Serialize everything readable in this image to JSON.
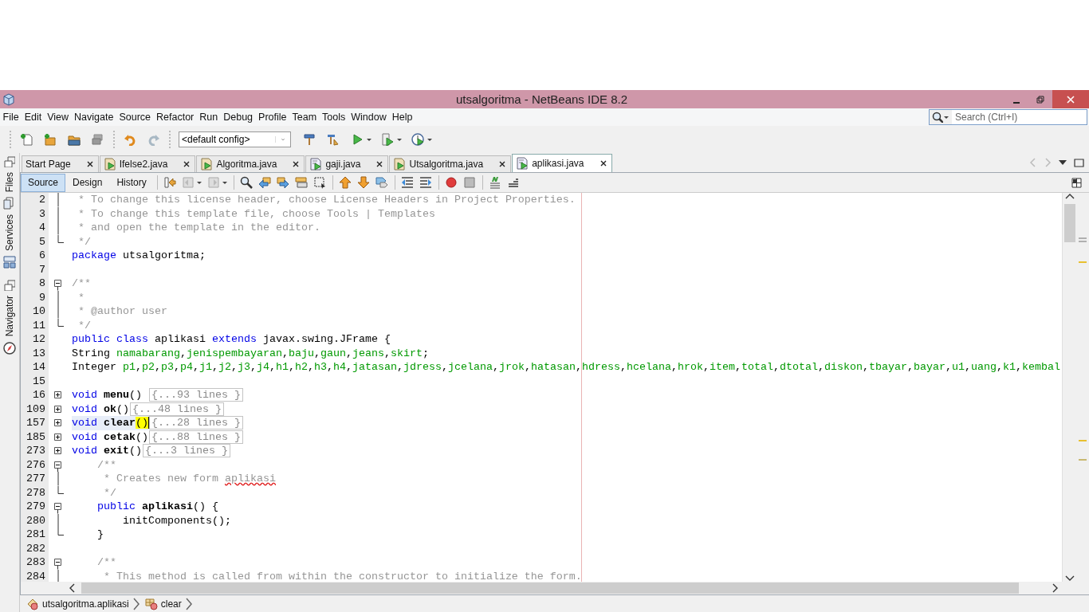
{
  "window": {
    "title": "utsalgoritma - NetBeans IDE 8.2"
  },
  "menu": [
    "File",
    "Edit",
    "View",
    "Navigate",
    "Source",
    "Refactor",
    "Run",
    "Debug",
    "Profile",
    "Team",
    "Tools",
    "Window",
    "Help"
  ],
  "search": {
    "placeholder": "Search (Ctrl+I)"
  },
  "toolbar": {
    "config": "<default config>"
  },
  "side_panels": [
    {
      "tabs": [
        {
          "label": "Files",
          "kind": "files"
        },
        {
          "label": "Services",
          "kind": "services"
        }
      ]
    },
    {
      "tabs": [
        {
          "label": "Navigator",
          "kind": "navigator"
        }
      ]
    }
  ],
  "tabs": [
    {
      "label": "Start Page",
      "kind": "page",
      "selected": false
    },
    {
      "label": "Ifelse2.java",
      "kind": "main",
      "selected": false
    },
    {
      "label": "Algoritma.java",
      "kind": "main",
      "selected": false
    },
    {
      "label": "gaji.java",
      "kind": "form",
      "selected": false
    },
    {
      "label": "Utsalgoritma.java",
      "kind": "main",
      "selected": false
    },
    {
      "label": "aplikasi.java",
      "kind": "form",
      "selected": true
    }
  ],
  "view_tabs": [
    {
      "label": "Source",
      "selected": true
    },
    {
      "label": "Design",
      "selected": false
    },
    {
      "label": "History",
      "selected": false
    }
  ],
  "code": [
    {
      "number": "2",
      "kind": "guide",
      "current": false,
      "tokens": [
        {
          "kind": "comment",
          "text": " * To change this license header, choose License Headers in Project Properties."
        }
      ]
    },
    {
      "number": "3",
      "kind": "guide",
      "current": false,
      "tokens": [
        {
          "kind": "comment",
          "text": " * To change this template file, choose Tools | Templates"
        }
      ]
    },
    {
      "number": "4",
      "kind": "guide",
      "current": false,
      "tokens": [
        {
          "kind": "comment",
          "text": " * and open the template in the editor."
        }
      ]
    },
    {
      "number": "5",
      "kind": "end",
      "current": false,
      "tokens": [
        {
          "kind": "comment",
          "text": " */"
        }
      ]
    },
    {
      "number": "6",
      "kind": "plain",
      "current": false,
      "tokens": [
        {
          "kind": "kw",
          "text": "package"
        },
        {
          "kind": "plain",
          "text": " utsalgoritma;"
        }
      ]
    },
    {
      "number": "7",
      "kind": "plain",
      "current": false
    },
    {
      "number": "8",
      "kind": "collapse",
      "current": false,
      "tokens": [
        {
          "kind": "comment",
          "text": "/**"
        }
      ]
    },
    {
      "number": "9",
      "kind": "guide",
      "current": false,
      "tokens": [
        {
          "kind": "comment",
          "text": " *"
        }
      ]
    },
    {
      "number": "10",
      "kind": "guide",
      "current": false,
      "tokens": [
        {
          "kind": "comment",
          "text": " * @author user"
        }
      ]
    },
    {
      "number": "11",
      "kind": "end",
      "current": false,
      "tokens": [
        {
          "kind": "comment",
          "text": " */"
        }
      ]
    },
    {
      "number": "12",
      "kind": "plain",
      "current": false,
      "tokens": [
        {
          "kind": "kw",
          "text": "public class"
        },
        {
          "kind": "plain",
          "text": " aplikasi "
        },
        {
          "kind": "kw",
          "text": "extends"
        },
        {
          "kind": "plain",
          "text": " javax.swing.JFrame {"
        }
      ]
    },
    {
      "number": "13",
      "kind": "plain",
      "current": false,
      "tokens": [
        {
          "kind": "plain",
          "text": "String "
        },
        {
          "kind": "field",
          "text": "namabarang"
        },
        {
          "kind": "plain",
          "text": ","
        },
        {
          "kind": "field",
          "text": "jenispembayaran"
        },
        {
          "kind": "plain",
          "text": ","
        },
        {
          "kind": "field",
          "text": "baju"
        },
        {
          "kind": "plain",
          "text": ","
        },
        {
          "kind": "field",
          "text": "gaun"
        },
        {
          "kind": "plain",
          "text": ","
        },
        {
          "kind": "field",
          "text": "jeans"
        },
        {
          "kind": "plain",
          "text": ","
        },
        {
          "kind": "field",
          "text": "skirt"
        },
        {
          "kind": "plain",
          "text": ";"
        }
      ]
    },
    {
      "number": "14",
      "kind": "plain",
      "current": false,
      "tokens": [
        {
          "kind": "plain",
          "text": "Integer "
        },
        {
          "kind": "field",
          "text": "p1"
        },
        {
          "kind": "plain",
          "text": ","
        },
        {
          "kind": "field",
          "text": "p2"
        },
        {
          "kind": "plain",
          "text": ","
        },
        {
          "kind": "field",
          "text": "p3"
        },
        {
          "kind": "plain",
          "text": ","
        },
        {
          "kind": "field",
          "text": "p4"
        },
        {
          "kind": "plain",
          "text": ","
        },
        {
          "kind": "field",
          "text": "j1"
        },
        {
          "kind": "plain",
          "text": ","
        },
        {
          "kind": "field",
          "text": "j2"
        },
        {
          "kind": "plain",
          "text": ","
        },
        {
          "kind": "field",
          "text": "j3"
        },
        {
          "kind": "plain",
          "text": ","
        },
        {
          "kind": "field",
          "text": "j4"
        },
        {
          "kind": "plain",
          "text": ","
        },
        {
          "kind": "field",
          "text": "h1"
        },
        {
          "kind": "plain",
          "text": ","
        },
        {
          "kind": "field",
          "text": "h2"
        },
        {
          "kind": "plain",
          "text": ","
        },
        {
          "kind": "field",
          "text": "h3"
        },
        {
          "kind": "plain",
          "text": ","
        },
        {
          "kind": "field",
          "text": "h4"
        },
        {
          "kind": "plain",
          "text": ","
        },
        {
          "kind": "field",
          "text": "jatasan"
        },
        {
          "kind": "plain",
          "text": ","
        },
        {
          "kind": "field",
          "text": "jdress"
        },
        {
          "kind": "plain",
          "text": ","
        },
        {
          "kind": "field",
          "text": "jcelana"
        },
        {
          "kind": "plain",
          "text": ","
        },
        {
          "kind": "field",
          "text": "jrok"
        },
        {
          "kind": "plain",
          "text": ","
        },
        {
          "kind": "field",
          "text": "hatasan"
        },
        {
          "kind": "plain",
          "text": ","
        },
        {
          "kind": "field",
          "text": "hdress"
        },
        {
          "kind": "plain",
          "text": ","
        },
        {
          "kind": "field",
          "text": "hcelana"
        },
        {
          "kind": "plain",
          "text": ","
        },
        {
          "kind": "field",
          "text": "hrok"
        },
        {
          "kind": "plain",
          "text": ","
        },
        {
          "kind": "field",
          "text": "item"
        },
        {
          "kind": "plain",
          "text": ","
        },
        {
          "kind": "field",
          "text": "total"
        },
        {
          "kind": "plain",
          "text": ","
        },
        {
          "kind": "field",
          "text": "dtotal"
        },
        {
          "kind": "plain",
          "text": ","
        },
        {
          "kind": "field",
          "text": "diskon"
        },
        {
          "kind": "plain",
          "text": ","
        },
        {
          "kind": "field",
          "text": "tbayar"
        },
        {
          "kind": "plain",
          "text": ","
        },
        {
          "kind": "field",
          "text": "bayar"
        },
        {
          "kind": "plain",
          "text": ","
        },
        {
          "kind": "field",
          "text": "u1"
        },
        {
          "kind": "plain",
          "text": ","
        },
        {
          "kind": "field",
          "text": "uang"
        },
        {
          "kind": "plain",
          "text": ","
        },
        {
          "kind": "field",
          "text": "k1"
        },
        {
          "kind": "plain",
          "text": ","
        },
        {
          "kind": "field",
          "text": "kembal"
        }
      ]
    },
    {
      "number": "15",
      "kind": "plain",
      "current": false
    },
    {
      "number": "16",
      "kind": "expand",
      "current": false,
      "tokens": [
        {
          "kind": "kw",
          "text": "void"
        },
        {
          "kind": "bold",
          "text": " menu"
        },
        {
          "kind": "plain",
          "text": "() "
        }
      ],
      "folded": "{...93 lines }"
    },
    {
      "number": "109",
      "kind": "expand",
      "current": false,
      "tokens": [
        {
          "kind": "kw",
          "text": "void"
        },
        {
          "kind": "bold",
          "text": " ok"
        },
        {
          "kind": "plain",
          "text": "()"
        }
      ],
      "folded": "{...48 lines }"
    },
    {
      "number": "157",
      "kind": "expand",
      "current": true,
      "tokens": [
        {
          "kind": "kw",
          "text": "void"
        },
        {
          "kind": "bold",
          "text": " clear"
        },
        {
          "kind": "match",
          "text": "()"
        }
      ],
      "folded": "{...28 lines }"
    },
    {
      "number": "185",
      "kind": "expand",
      "current": false,
      "tokens": [
        {
          "kind": "kw",
          "text": "void"
        },
        {
          "kind": "bold",
          "text": " cetak"
        },
        {
          "kind": "plain",
          "text": "()"
        }
      ],
      "folded": "{...88 lines }"
    },
    {
      "number": "273",
      "kind": "expand",
      "current": false,
      "tokens": [
        {
          "kind": "kw",
          "text": "void"
        },
        {
          "kind": "bold",
          "text": " exit"
        },
        {
          "kind": "plain",
          "text": "()"
        }
      ],
      "folded": "{...3 lines }"
    },
    {
      "number": "276",
      "kind": "collapse",
      "current": false,
      "tokens": [
        {
          "kind": "comment",
          "text": "    /**"
        }
      ]
    },
    {
      "number": "277",
      "kind": "guide",
      "current": false,
      "tokens": [
        {
          "kind": "comment",
          "text": "     * Creates new form "
        },
        {
          "kind": "misspelled",
          "text": "aplikasi"
        }
      ]
    },
    {
      "number": "278",
      "kind": "end",
      "current": false,
      "tokens": [
        {
          "kind": "comment",
          "text": "     */"
        }
      ]
    },
    {
      "number": "279",
      "kind": "collapse",
      "current": false,
      "tokens": [
        {
          "kind": "kw",
          "text": "    public"
        },
        {
          "kind": "bold",
          "text": " aplikasi"
        },
        {
          "kind": "plain",
          "text": "() {"
        }
      ]
    },
    {
      "number": "280",
      "kind": "guide",
      "current": false,
      "tokens": [
        {
          "kind": "plain",
          "text": "        initComponents();"
        }
      ]
    },
    {
      "number": "281",
      "kind": "end",
      "current": false,
      "tokens": [
        {
          "kind": "plain",
          "text": "    }"
        }
      ]
    },
    {
      "number": "282",
      "kind": "plain",
      "current": false
    },
    {
      "number": "283",
      "kind": "collapse",
      "current": false,
      "tokens": [
        {
          "kind": "comment",
          "text": "    /**"
        }
      ]
    },
    {
      "number": "284",
      "kind": "guide",
      "current": false,
      "tokens": [
        {
          "kind": "comment",
          "text": "     * This method is called from within the constructor to initialize the form."
        }
      ]
    }
  ],
  "breadcrumbs": [
    {
      "label": "utsalgoritma.aplikasi",
      "kind": "class"
    },
    {
      "label": "clear",
      "kind": "method"
    }
  ]
}
